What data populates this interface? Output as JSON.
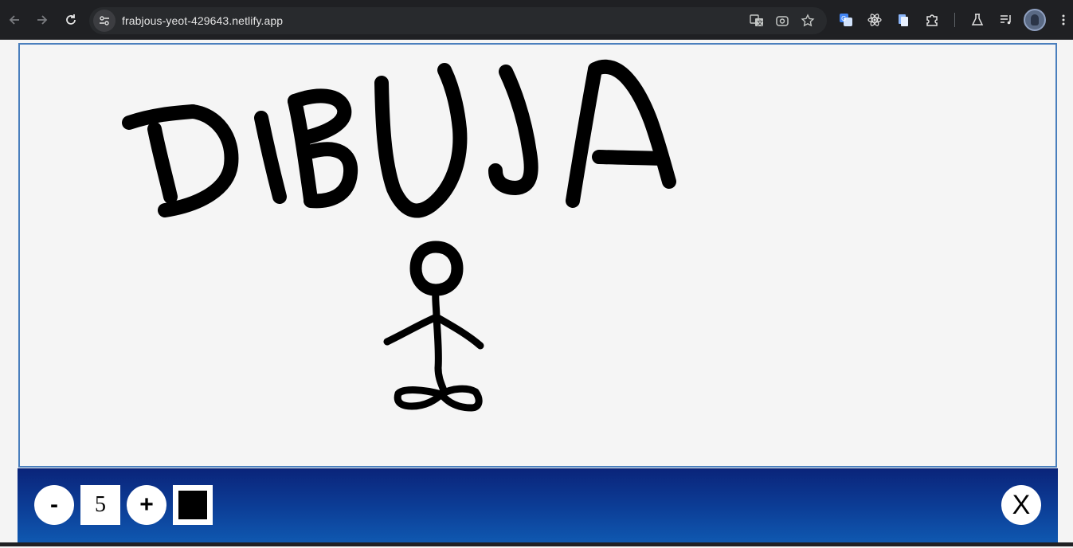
{
  "browser": {
    "url": "frabjous-yeot-429643.netlify.app"
  },
  "canvas": {
    "background": "#f5f5f5",
    "border_color": "#4a7fbd",
    "stroke_color": "#000000"
  },
  "toolbar": {
    "decrease_label": "-",
    "brush_size": "5",
    "increase_label": "+",
    "selected_color": "#000000",
    "close_label": "X"
  }
}
